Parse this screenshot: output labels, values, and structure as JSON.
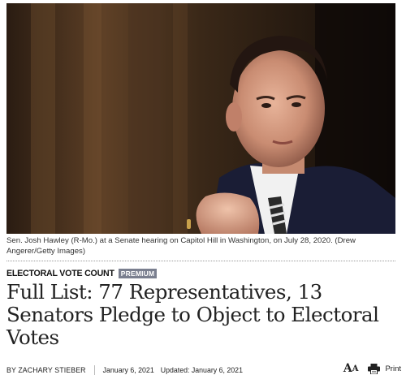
{
  "article": {
    "image": {
      "alt_subject": "senator-portrait",
      "caption": "Sen. Josh Hawley (R-Mo.) at a Senate hearing on Capitol Hill in Washington, on July 28, 2020. (Drew Angerer/Getty Images)"
    },
    "category": "ELECTORAL VOTE COUNT",
    "badge": "PREMIUM",
    "headline": "Full List: 77 Representatives, 13 Senators Pledge to Object to Electoral Votes",
    "author": "BY ZACHARY STIEBER",
    "published": "January 6, 2021",
    "updated": "Updated: January 6, 2021",
    "tools": {
      "font_size_icon": "font-size-icon",
      "font_size_label": "A",
      "print_icon": "printer-icon",
      "print_label": "Print"
    }
  },
  "colors": {
    "badge_bg": "#7a7f8f",
    "text": "#111111",
    "divider": "#9a9a9a"
  }
}
